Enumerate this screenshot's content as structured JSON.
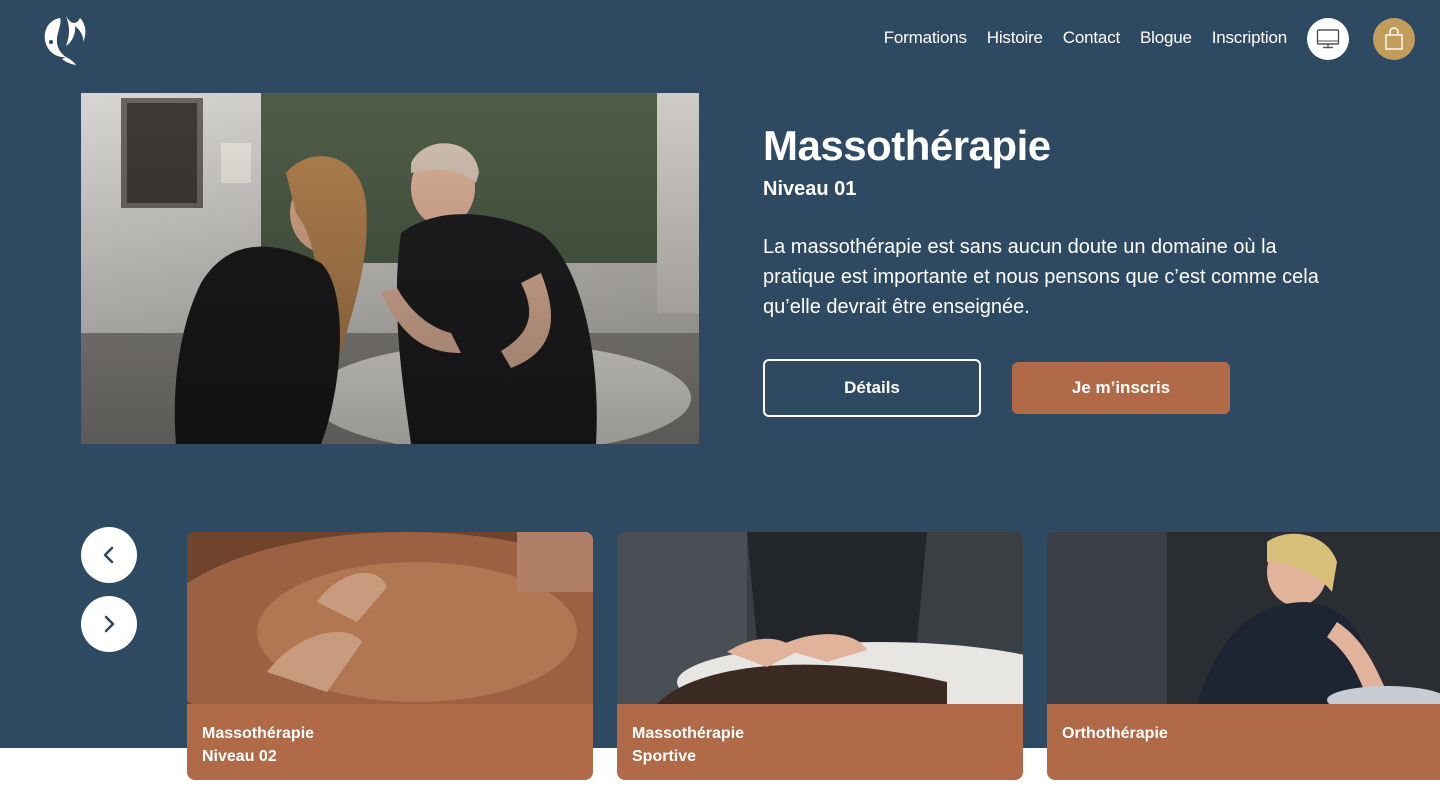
{
  "header": {
    "logo_icon": "bird-logo-icon",
    "nav": [
      "Formations",
      "Histoire",
      "Contact",
      "Blogue",
      "Inscription"
    ],
    "screen_icon": "monitor-icon",
    "bag_icon": "shopping-bag-icon"
  },
  "hero": {
    "title": "Massothérapie",
    "level": "Niveau 01",
    "description": "La massothérapie est sans aucun doute un domaine où la pratique est importante et nous pensons que c’est comme cela qu’elle devrait être enseignée.",
    "details_label": "Détails",
    "register_label": "Je m’inscris"
  },
  "carousel": {
    "prev_icon": "chevron-left-icon",
    "next_icon": "chevron-right-icon",
    "cards": [
      {
        "line1": "Massothérapie",
        "line2": "Niveau 02"
      },
      {
        "line1": "Massothérapie",
        "line2": "Sportive"
      },
      {
        "line1": "Orthothérapie",
        "line2": ""
      }
    ]
  },
  "colors": {
    "hero_background": "#2e4a62",
    "accent_brown": "#b06a48",
    "bag_gold": "#c19c5b",
    "white": "#ffffff"
  }
}
